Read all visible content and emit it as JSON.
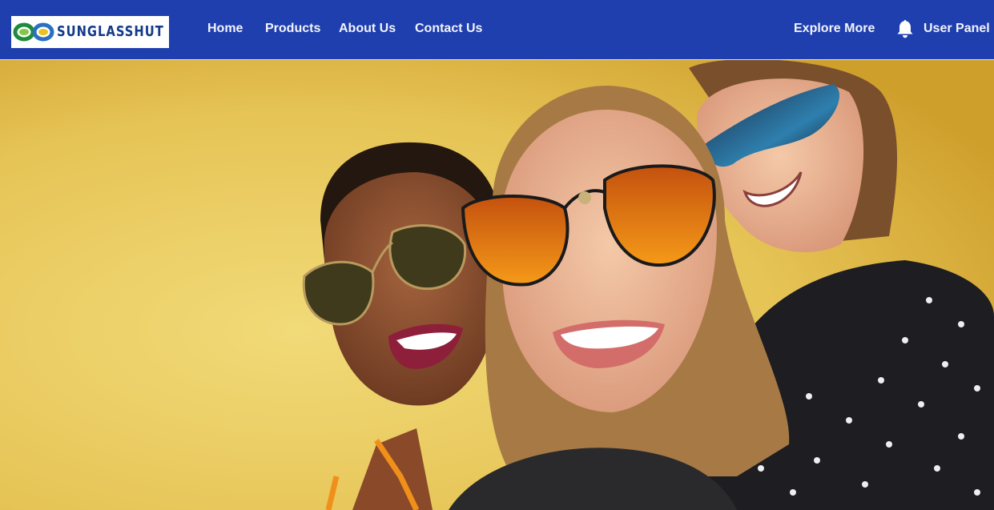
{
  "brand": {
    "name": "SUNGLASSHUT",
    "logo_icon": "sunglasses-logo-icon"
  },
  "nav": {
    "links": [
      {
        "label": "Home"
      },
      {
        "label": "Products"
      },
      {
        "label": "About Us"
      },
      {
        "label": "Contact Us"
      }
    ],
    "explore_label": "Explore More",
    "bell_icon": "bell-icon",
    "user_panel_label": "User Panel"
  },
  "hero": {
    "image": "three-friends-wearing-sunglasses-photo"
  },
  "colors": {
    "navbar": "#1f3fae",
    "hero_background": "#e8c75a",
    "logo_text": "#123a8a"
  }
}
